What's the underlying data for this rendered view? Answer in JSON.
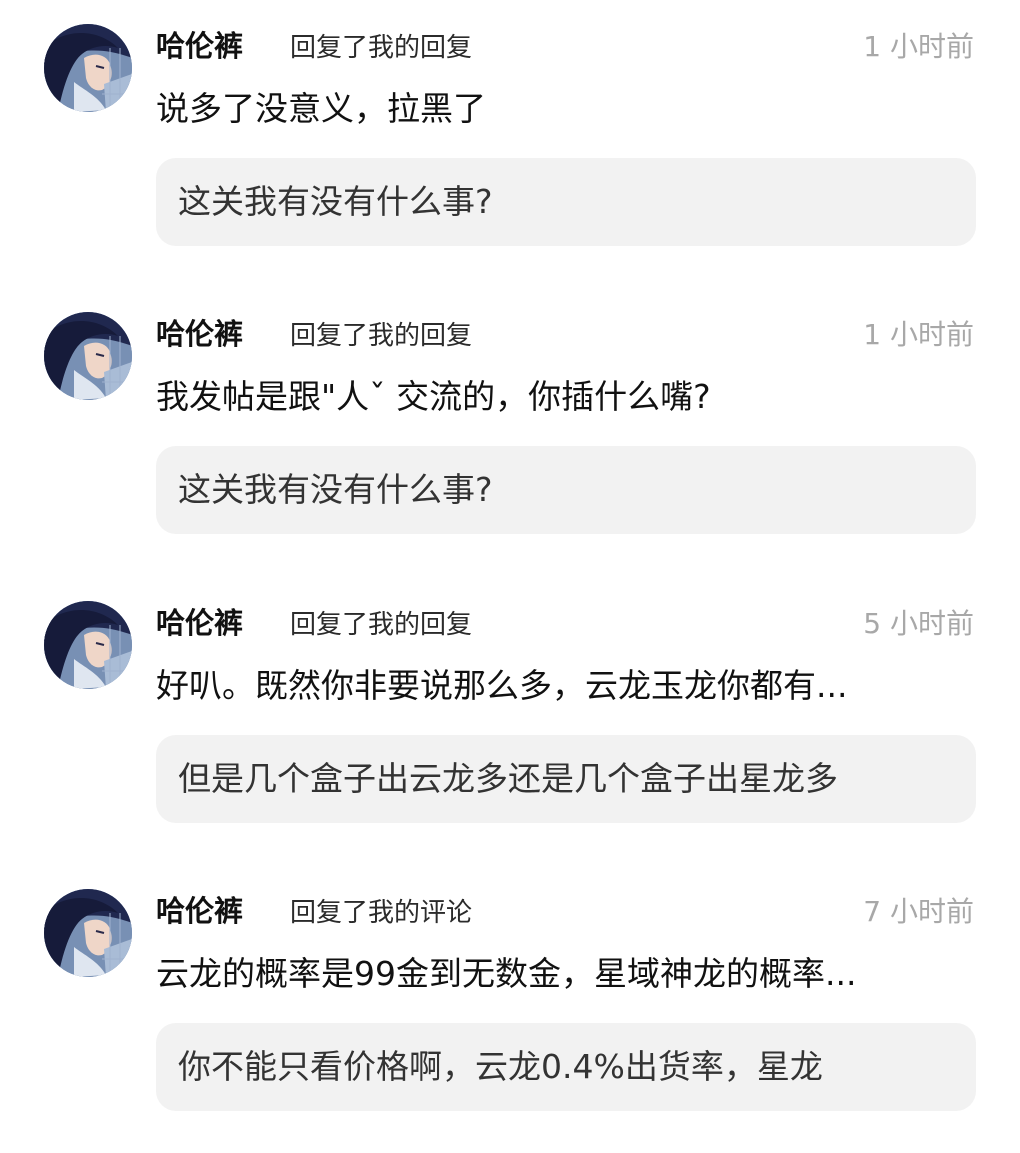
{
  "notifications": [
    {
      "username": "哈伦裤",
      "action": "回复了我的回复",
      "time": "1 小时前",
      "message": "说多了没意义，拉黑了",
      "quoted": "这关我有没有什么事?"
    },
    {
      "username": "哈伦裤",
      "action": "回复了我的回复",
      "time": "1 小时前",
      "message": "我发帖是跟\"人ˇ 交流的，你插什么嘴?",
      "quoted": "这关我有没有什么事?"
    },
    {
      "username": "哈伦裤",
      "action": "回复了我的回复",
      "time": "5 小时前",
      "message": "好叭。既然你非要说那么多，云龙玉龙你都有...",
      "quoted": "但是几个盒子出云龙多还是几个盒子出星龙多"
    },
    {
      "username": "哈伦裤",
      "action": "回复了我的评论",
      "time": "7 小时前",
      "message": "云龙的概率是99金到无数金，星域神龙的概率...",
      "quoted": "你不能只看价格啊，云龙0.4%出货率，星龙"
    }
  ],
  "avatar": {
    "icon": "anime-girl-avatar",
    "colors": {
      "background": "#6f86ad",
      "hair": "#1b2247",
      "face": "#efd6c8"
    }
  },
  "colors": {
    "username": "#111111",
    "action": "#2b2b2b",
    "time": "#a8a8a8",
    "quote_background": "#f2f2f2",
    "quote_text": "#333333"
  }
}
